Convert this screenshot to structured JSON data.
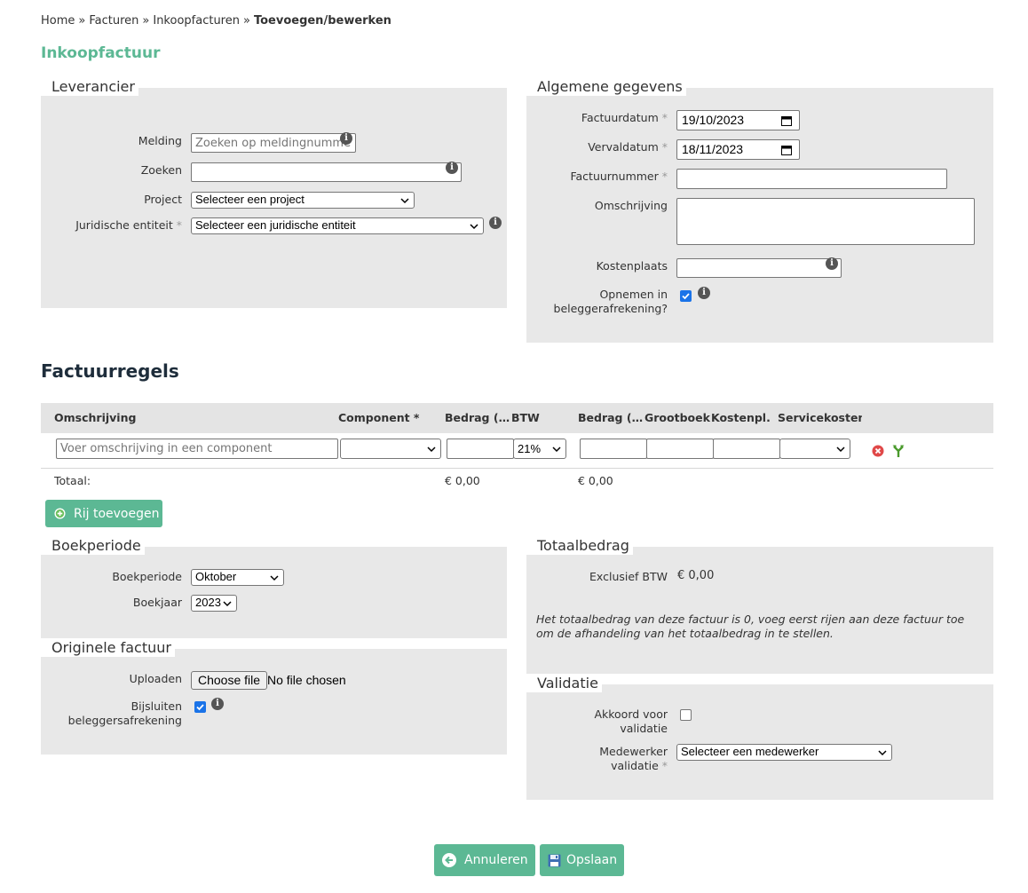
{
  "breadcrumb": {
    "home": "Home",
    "facturen": "Facturen",
    "inkoop": "Inkoopfacturen",
    "current": "Toevoegen/bewerken",
    "sep": "»"
  },
  "page_title": "Inkoopfactuur",
  "leverancier": {
    "legend": "Leverancier",
    "melding_label": "Melding",
    "melding_placeholder": "Zoeken op meldingnummer",
    "zoeken_label": "Zoeken",
    "project_label": "Project",
    "project_value": "Selecteer een project",
    "entiteit_label": "Juridische entiteit",
    "entiteit_value": "Selecteer een juridische entiteit"
  },
  "algemeen": {
    "legend": "Algemene gegevens",
    "factuurdatum_label": "Factuurdatum",
    "factuurdatum_value": "19/10/2023",
    "vervaldatum_label": "Vervaldatum",
    "vervaldatum_value": "18/11/2023",
    "factuurnummer_label": "Factuurnummer",
    "omschrijving_label": "Omschrijving",
    "kostenplaats_label": "Kostenplaats",
    "opnemen_label_1": "Opnemen in",
    "opnemen_label_2": "beleggerafrekening?",
    "opnemen_checked": true
  },
  "required_mark": "*",
  "factuurregels": {
    "title": "Factuurregels",
    "headers": {
      "omschrijving": "Omschrijving",
      "component": "Component *",
      "bedrag_ex": "Bedrag (exclusief BTW)",
      "btw": "BTW",
      "bedrag_inc": "Bedrag (inclusief BTW)",
      "grootboek": "Grootboek",
      "kostenpl": "Kostenpl.",
      "servicekosten": "Servicekosten"
    },
    "row": {
      "omschrijving_placeholder": "Voer omschrijving in een component",
      "btw_value": "21%"
    },
    "totaal_label": "Totaal:",
    "totaal_ex": "€ 0,00",
    "totaal_inc": "€ 0,00",
    "add_row_label": "Rij toevoegen"
  },
  "boekperiode": {
    "legend": "Boekperiode",
    "periode_label": "Boekperiode",
    "periode_value": "Oktober",
    "jaar_label": "Boekjaar",
    "jaar_value": "2023"
  },
  "originele": {
    "legend": "Originele factuur",
    "uploaden_label": "Uploaden",
    "choose_file": "Choose file",
    "no_file": "No file chosen",
    "bijsluiten_label_1": "Bijsluiten",
    "bijsluiten_label_2": "beleggersafrekening",
    "bijsluiten_checked": true
  },
  "totaalbedrag": {
    "legend": "Totaalbedrag",
    "excl_label": "Exclusief BTW",
    "excl_value": "€ 0,00",
    "note": "Het totaalbedrag van deze factuur is 0, voeg eerst rijen aan deze factuur toe om de afhandeling van het totaalbedrag in te stellen."
  },
  "validatie": {
    "legend": "Validatie",
    "akkoord_label_1": "Akkoord voor",
    "akkoord_label_2": "validatie",
    "akkoord_checked": false,
    "medewerker_label_1": "Medewerker",
    "medewerker_label_2": "validatie",
    "medewerker_value": "Selecteer een medewerker"
  },
  "actions": {
    "cancel": "Annuleren",
    "save": "Opslaan"
  },
  "colors": {
    "accent": "#5cb894",
    "panel": "#e8e8e8",
    "title": "#1e2d3b"
  }
}
